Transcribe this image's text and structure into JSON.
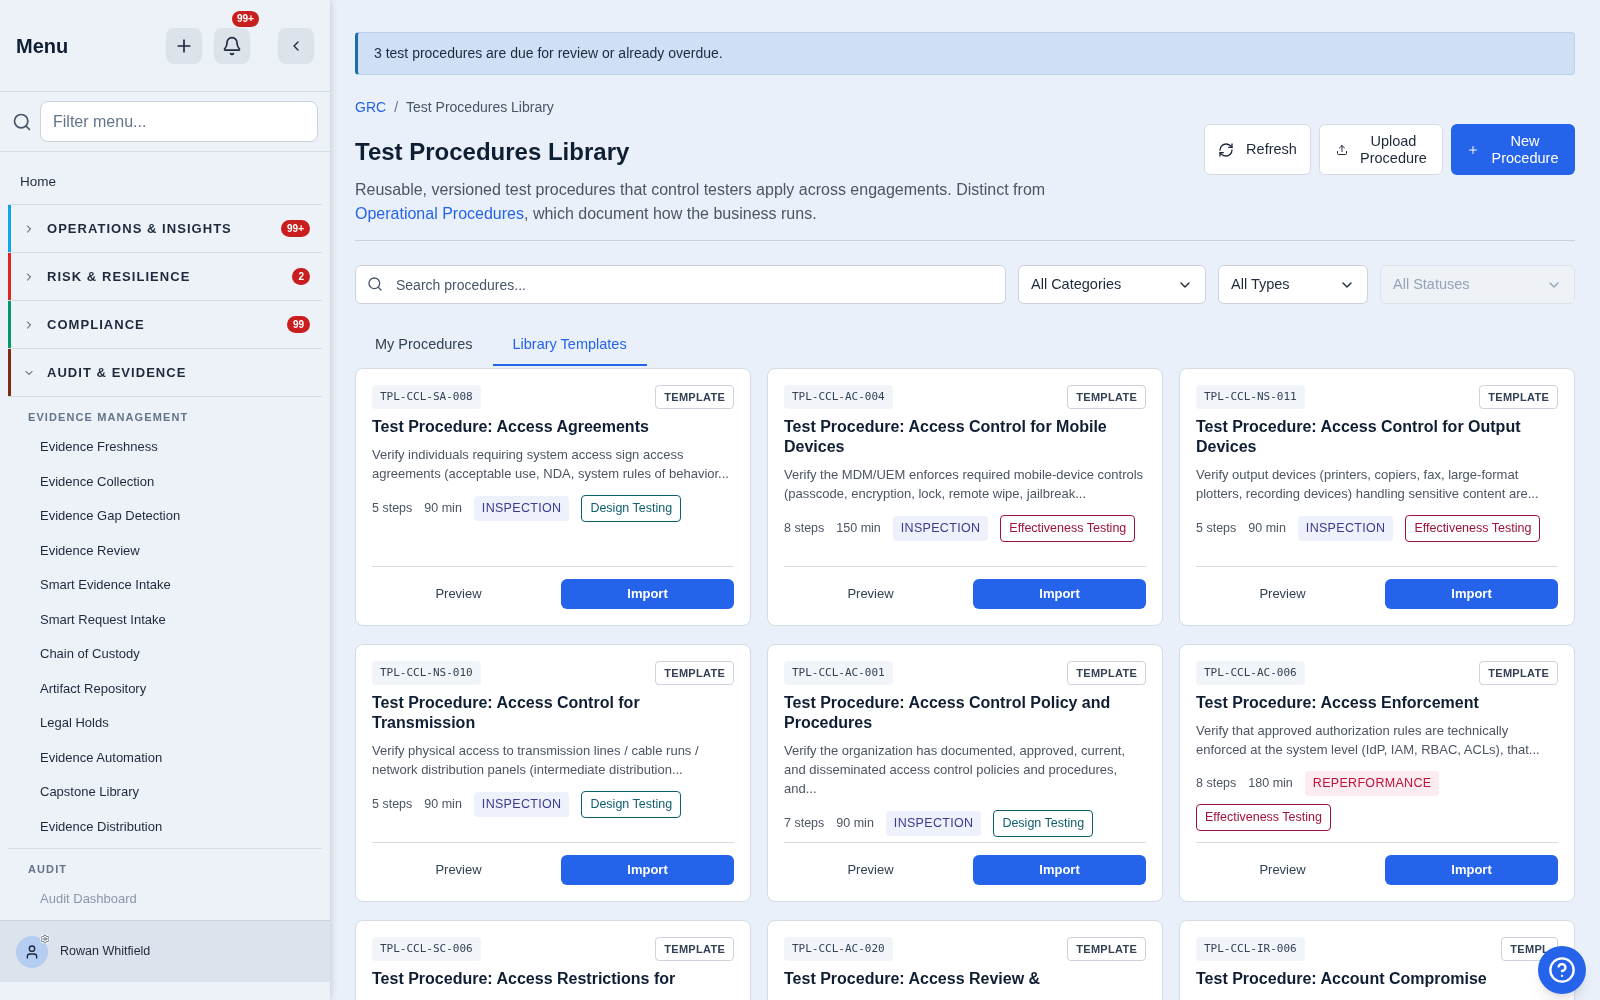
{
  "sidebar": {
    "title": "Menu",
    "notification_count": "99+",
    "filter_placeholder": "Filter menu...",
    "home": "Home",
    "sections": [
      {
        "label": "OPERATIONS & INSIGHTS",
        "color": "#0ea5e9",
        "badge": "99+",
        "expanded": false
      },
      {
        "label": "RISK & RESILIENCE",
        "color": "#dc2626",
        "badge": "2",
        "expanded": false
      },
      {
        "label": "COMPLIANCE",
        "color": "#059669",
        "badge": "99",
        "expanded": false
      },
      {
        "label": "AUDIT & EVIDENCE",
        "color": "#7c2d12",
        "expanded": true,
        "groups": [
          {
            "heading": "EVIDENCE MANAGEMENT",
            "items": [
              {
                "label": "Evidence Freshness",
                "disabled": false
              },
              {
                "label": "Evidence Collection",
                "disabled": false
              },
              {
                "label": "Evidence Gap Detection",
                "disabled": false
              },
              {
                "label": "Evidence Review",
                "disabled": false
              },
              {
                "label": "Smart Evidence Intake",
                "disabled": false
              },
              {
                "label": "Smart Request Intake",
                "disabled": false
              },
              {
                "label": "Chain of Custody",
                "disabled": false
              },
              {
                "label": "Artifact Repository",
                "disabled": false
              },
              {
                "label": "Legal Holds",
                "disabled": false
              },
              {
                "label": "Evidence Automation",
                "disabled": false
              },
              {
                "label": "Capstone Library",
                "disabled": false
              },
              {
                "label": "Evidence Distribution",
                "disabled": false
              }
            ]
          },
          {
            "heading": "AUDIT",
            "items": [
              {
                "label": "Audit Dashboard",
                "disabled": true
              }
            ]
          }
        ]
      }
    ],
    "user": "Rowan Whitfield"
  },
  "banner": "3 test procedures are due for review or already overdue.",
  "breadcrumb": {
    "separator": "/",
    "items": [
      "GRC",
      "Test Procedures Library"
    ]
  },
  "page": {
    "title": "Test Procedures Library",
    "description_before": "Reusable, versioned test procedures that control testers apply across engagements. Distinct from ",
    "description_link": "Operational Procedures",
    "description_after": ", which document how the business runs."
  },
  "actions": [
    {
      "label": "Refresh",
      "kind": "refresh"
    },
    {
      "label": "Upload Procedure",
      "kind": "upload"
    },
    {
      "label": "New Procedure",
      "kind": "new"
    }
  ],
  "filters": {
    "search_placeholder": "Search procedures...",
    "selects": [
      {
        "value": "All Categories",
        "disabled": false
      },
      {
        "value": "All Types",
        "disabled": false
      },
      {
        "value": "All Statuses",
        "disabled": true
      }
    ]
  },
  "tabs": [
    {
      "label": "My Procedures",
      "selected": false
    },
    {
      "label": "Library Templates",
      "selected": true
    }
  ],
  "cards": [
    {
      "code": "TPL-CCL-SA-008",
      "badge": "TEMPLATE",
      "title": "Test Procedure: Access Agreements",
      "description": "Verify individuals requiring system access sign access agreements (acceptable use, NDA, system rules of behavior...",
      "steps": "5 steps",
      "duration": "90 min",
      "tags": [
        {
          "label": "INSPECTION",
          "kind": "inspection"
        },
        {
          "label": "Design Testing",
          "kind": "design"
        }
      ],
      "preview": "Preview",
      "import": "Import"
    },
    {
      "code": "TPL-CCL-AC-004",
      "badge": "TEMPLATE",
      "title": "Test Procedure: Access Control for Mobile Devices",
      "description": "Verify the MDM/UEM enforces required mobile-device controls (passcode, encryption, lock, remote wipe, jailbreak...",
      "steps": "8 steps",
      "duration": "150 min",
      "tags": [
        {
          "label": "INSPECTION",
          "kind": "inspection"
        },
        {
          "label": "Effectiveness Testing",
          "kind": "effectiveness"
        }
      ],
      "preview": "Preview",
      "import": "Import"
    },
    {
      "code": "TPL-CCL-NS-011",
      "badge": "TEMPLATE",
      "title": "Test Procedure: Access Control for Output Devices",
      "description": "Verify output devices (printers, copiers, fax, large-format plotters, recording devices) handling sensitive content are...",
      "steps": "5 steps",
      "duration": "90 min",
      "tags": [
        {
          "label": "INSPECTION",
          "kind": "inspection"
        },
        {
          "label": "Effectiveness Testing",
          "kind": "effectiveness"
        }
      ],
      "preview": "Preview",
      "import": "Import"
    },
    {
      "code": "TPL-CCL-NS-010",
      "badge": "TEMPLATE",
      "title": "Test Procedure: Access Control for Transmission",
      "description": "Verify physical access to transmission lines / cable runs / network distribution panels (intermediate distribution...",
      "steps": "5 steps",
      "duration": "90 min",
      "tags": [
        {
          "label": "INSPECTION",
          "kind": "inspection"
        },
        {
          "label": "Design Testing",
          "kind": "design"
        }
      ],
      "preview": "Preview",
      "import": "Import"
    },
    {
      "code": "TPL-CCL-AC-001",
      "badge": "TEMPLATE",
      "title": "Test Procedure: Access Control Policy and Procedures",
      "description": "Verify the organization has documented, approved, current, and disseminated access control policies and procedures, and...",
      "steps": "7 steps",
      "duration": "90 min",
      "tags": [
        {
          "label": "INSPECTION",
          "kind": "inspection"
        },
        {
          "label": "Design Testing",
          "kind": "design"
        }
      ],
      "preview": "Preview",
      "import": "Import"
    },
    {
      "code": "TPL-CCL-AC-006",
      "badge": "TEMPLATE",
      "title": "Test Procedure: Access Enforcement",
      "description": "Verify that approved authorization rules are technically enforced at the system level (IdP, IAM, RBAC, ACLs), that...",
      "steps": "8 steps",
      "duration": "180 min",
      "tags": [
        {
          "label": "REPERFORMANCE",
          "kind": "reperformance"
        },
        {
          "label": "Effectiveness Testing",
          "kind": "effectiveness"
        }
      ],
      "preview": "Preview",
      "import": "Import"
    },
    {
      "code": "TPL-CCL-SC-006",
      "badge": "TEMPLATE",
      "title": "Test Procedure: Access Restrictions for"
    },
    {
      "code": "TPL-CCL-AC-020",
      "badge": "TEMPLATE",
      "title": "Test Procedure: Access Review &"
    },
    {
      "code": "TPL-CCL-IR-006",
      "badge": "TEMPL",
      "title": "Test Procedure: Account Compromise"
    }
  ]
}
